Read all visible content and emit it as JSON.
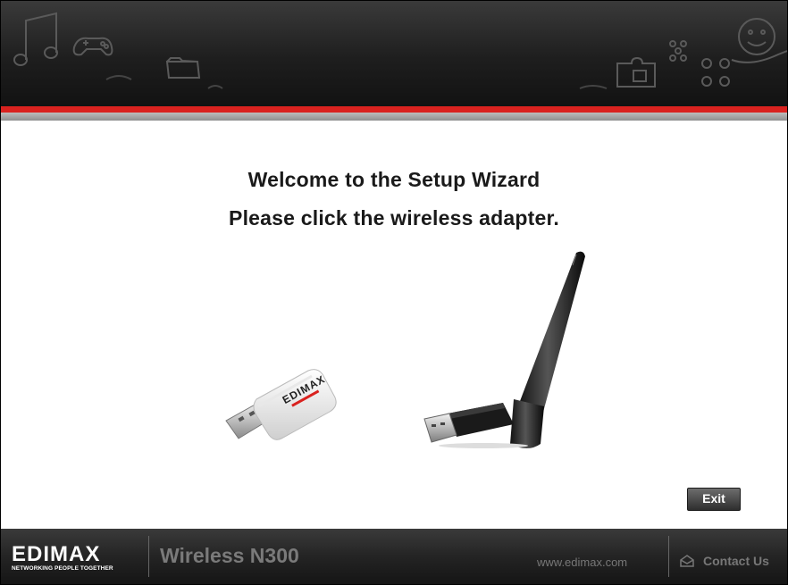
{
  "heading": {
    "line1": "Welcome to the Setup Wizard",
    "line2": "Please click the wireless adapter."
  },
  "adapters": {
    "mini_brand": "EDIMAX"
  },
  "header": {
    "decor_icons": [
      "music-note-icon",
      "gamepad-icon",
      "folder-icon",
      "puzzle-icon",
      "network-icon",
      "smiley-icon"
    ]
  },
  "buttons": {
    "exit_label": "Exit"
  },
  "footer": {
    "logo_text": "EDIMAX",
    "logo_tagline": "NETWORKING PEOPLE TOGETHER",
    "product_name": "Wireless N300",
    "website": "www.edimax.com",
    "contact_label": "Contact Us",
    "contact_icon": "envelope-icon"
  },
  "colors": {
    "accent_red": "#d9221f",
    "header_dark": "#1e1e1e"
  }
}
